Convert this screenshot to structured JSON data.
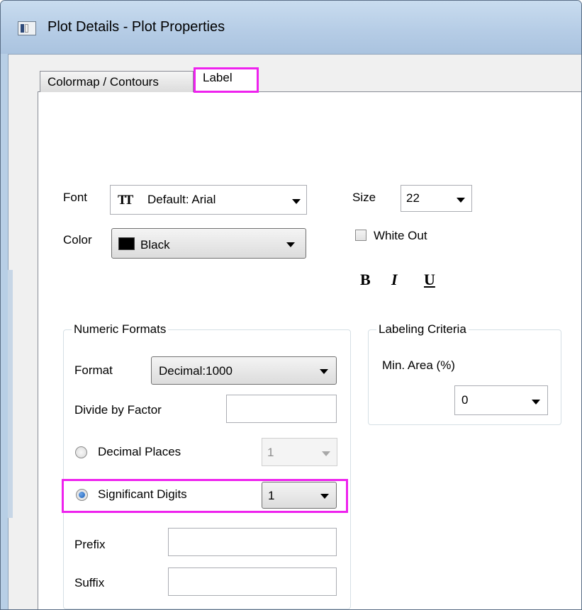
{
  "window": {
    "title": "Plot Details - Plot Properties"
  },
  "tabs": [
    {
      "label": "Colormap / Contours",
      "active": false
    },
    {
      "label": "Label",
      "active": true
    }
  ],
  "font": {
    "label": "Font",
    "value": "Default: Arial",
    "icon": "truetype-font-icon",
    "size_label": "Size",
    "size_value": "22"
  },
  "color": {
    "label": "Color",
    "value": "Black",
    "swatch": "#000000"
  },
  "white_out": {
    "label": "White Out",
    "checked": false
  },
  "style_buttons": {
    "bold": "B",
    "italic": "I",
    "underline": "U"
  },
  "numeric_formats": {
    "title": "Numeric Formats",
    "format_label": "Format",
    "format_value": "Decimal:1000",
    "divide_label": "Divide by Factor",
    "divide_value": "",
    "decimal_places_label": "Decimal Places",
    "decimal_places_value": "1",
    "decimal_places_selected": false,
    "significant_digits_label": "Significant Digits",
    "significant_digits_value": "1",
    "significant_digits_selected": true,
    "prefix_label": "Prefix",
    "prefix_value": "",
    "suffix_label": "Suffix",
    "suffix_value": ""
  },
  "labeling_criteria": {
    "title": "Labeling Criteria",
    "min_area_label": "Min. Area (%)",
    "min_area_value": "0"
  },
  "colors": {
    "highlight": "#ee22ee",
    "titlebar": "#b9cfe6",
    "radio_dot": "#1b5fb8"
  }
}
